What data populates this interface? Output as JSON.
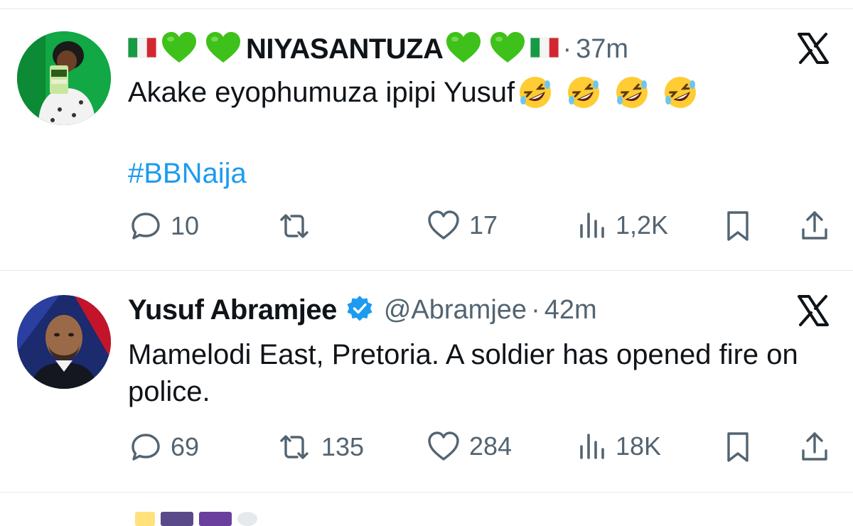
{
  "tweets": [
    {
      "display_name": "NIYASANTUZA",
      "time": "37m",
      "text": "Akake eyophumuza ipipi Yusuf",
      "hashtag": "#BBNaija",
      "replies": "10",
      "reposts": "",
      "likes": "17",
      "views": "1,2K"
    },
    {
      "display_name": "Yusuf Abramjee",
      "verified": true,
      "handle": "@Abramjee",
      "time": "42m",
      "text": "Mamelodi East, Pretoria. A soldier has opened fire on police.",
      "replies": "69",
      "reposts": "135",
      "likes": "284",
      "views": "18K"
    }
  ],
  "separator": "·",
  "colors": {
    "text": "#0f1419",
    "muted": "#536471",
    "link": "#1d9bf0",
    "divider": "#e6e9ec",
    "verified": "#1d9bf0",
    "heart_green": "#3ec11a"
  },
  "icons": [
    "italy-flag-icon",
    "green-heart-icon",
    "rofl-emoji-icon",
    "x-logo-icon",
    "reply-icon",
    "repost-icon",
    "like-icon",
    "views-icon",
    "bookmark-icon",
    "share-icon",
    "verified-badge-icon"
  ]
}
